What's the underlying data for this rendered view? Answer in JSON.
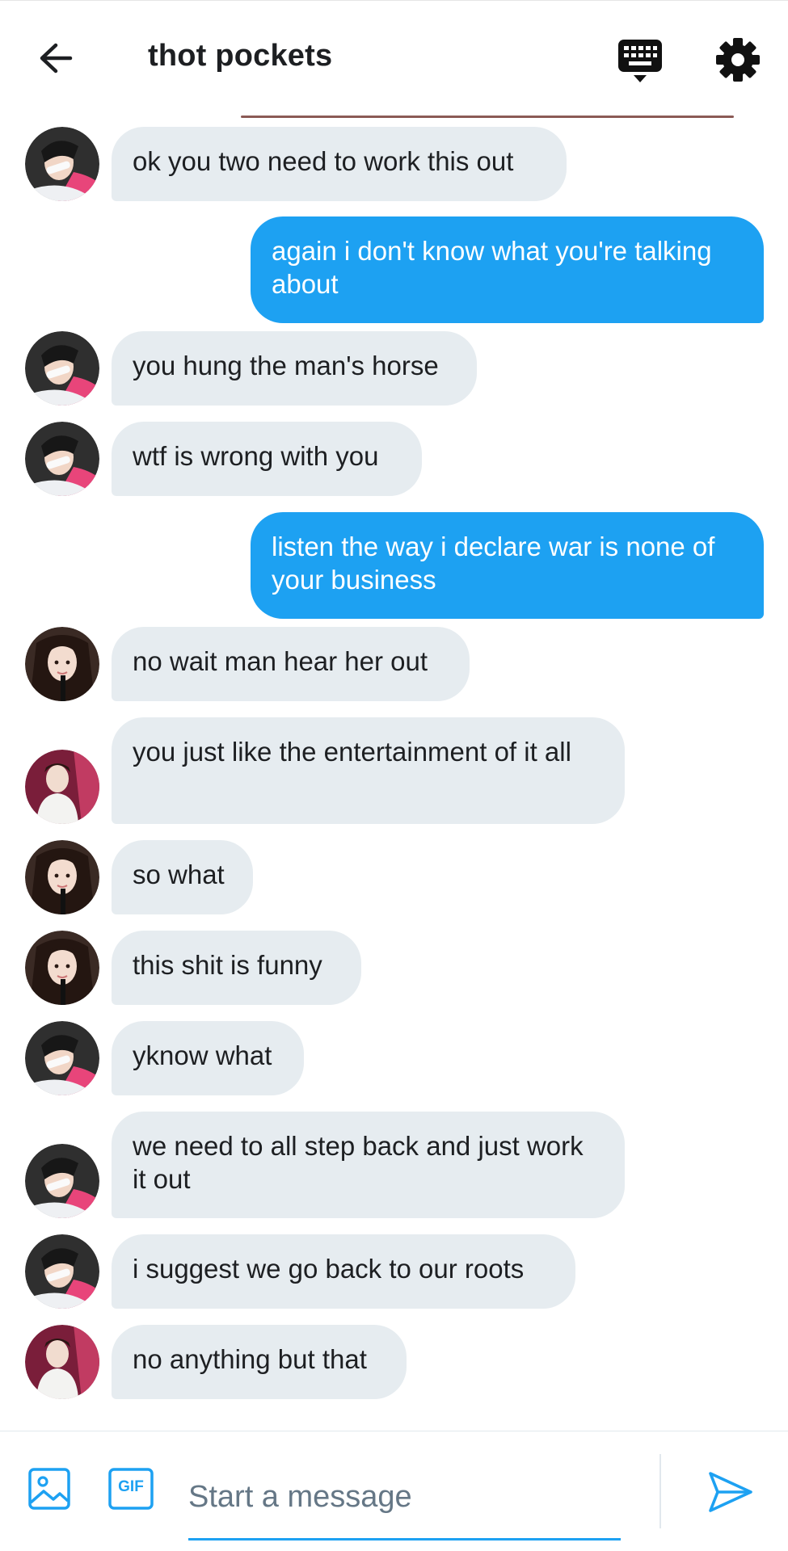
{
  "header": {
    "title": "thot pockets"
  },
  "messages": [
    {
      "side": "in",
      "avatar": "a",
      "text": "ok you two need to work this out"
    },
    {
      "side": "out",
      "text": "again i don't know what you're talking about"
    },
    {
      "side": "in",
      "avatar": "a",
      "text": "you hung the man's horse"
    },
    {
      "side": "in",
      "avatar": "a",
      "text": "wtf is wrong with you"
    },
    {
      "side": "out",
      "text": "listen the way i declare war is none of your business"
    },
    {
      "side": "in",
      "avatar": "b",
      "text": "no wait man hear her out"
    },
    {
      "side": "in",
      "avatar": "c",
      "text": "you just like the entertainment of it all"
    },
    {
      "side": "in",
      "avatar": "b",
      "text": "so what"
    },
    {
      "side": "in",
      "avatar": "b",
      "text": "this shit is funny"
    },
    {
      "side": "in",
      "avatar": "a",
      "text": "yknow what"
    },
    {
      "side": "in",
      "avatar": "a",
      "text": "we need to all step back and just work it out"
    },
    {
      "side": "in",
      "avatar": "a",
      "text": "i suggest we go back to our roots"
    },
    {
      "side": "in",
      "avatar": "c",
      "text": "no anything but that"
    }
  ],
  "composer": {
    "placeholder": "Start a message",
    "value": "",
    "gif_label": "GIF"
  },
  "icons": {
    "back": "arrow-left-icon",
    "keyboard": "keyboard-icon",
    "settings": "gear-icon",
    "image": "image-icon",
    "gif": "gif-icon",
    "send": "send-icon"
  },
  "colors": {
    "accent": "#1da1f2",
    "incoming_bubble": "#e6ecf0",
    "divider": "#8b5a55"
  }
}
